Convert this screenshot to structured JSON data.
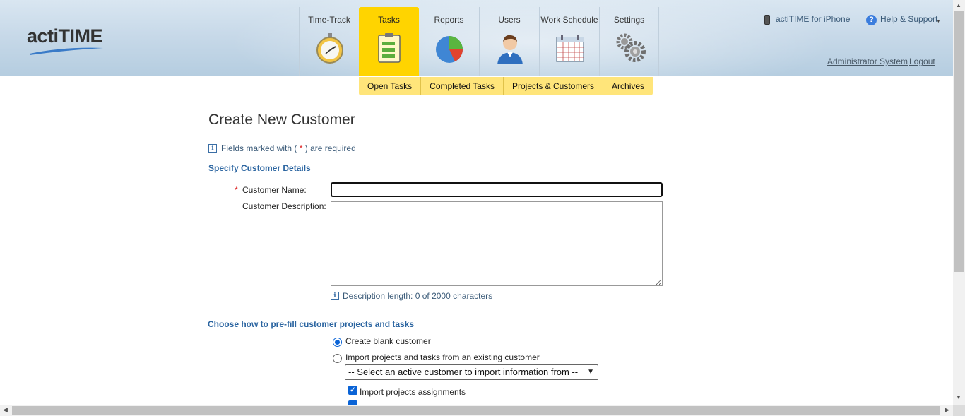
{
  "header": {
    "logo_text": "actiTIME",
    "nav_tabs": [
      {
        "label": "Time-Track",
        "icon": "stopwatch-icon",
        "active": false
      },
      {
        "label": "Tasks",
        "icon": "clipboard-icon",
        "active": true
      },
      {
        "label": "Reports",
        "icon": "pie-chart-icon",
        "active": false
      },
      {
        "label": "Users",
        "icon": "user-icon",
        "active": false
      },
      {
        "label": "Work Schedule",
        "icon": "calendar-icon",
        "active": false
      },
      {
        "label": "Settings",
        "icon": "gears-icon",
        "active": false
      }
    ],
    "iphone_link": "actiTIME for iPhone",
    "help_link": "Help & Support",
    "user_name": "Administrator System",
    "logout_link": "Logout",
    "active_color": "#ffd400"
  },
  "subnav": {
    "items": [
      "Open Tasks",
      "Completed Tasks",
      "Projects & Customers",
      "Archives"
    ]
  },
  "page": {
    "title": "Create New Customer",
    "required_note_prefix": "Fields marked with (",
    "required_star": "*",
    "required_note_suffix": ") are required",
    "section_details": "Specify Customer Details",
    "customer_name_label": "Customer Name:",
    "customer_name_value": "",
    "customer_description_label": "Customer Description:",
    "customer_description_value": "",
    "description_length_note": "Description length: 0 of 2000 characters",
    "section_prefill": "Choose how to pre-fill customer projects and tasks",
    "option_blank": "Create blank customer",
    "option_import": "Import projects and tasks from an existing customer",
    "import_select_value": "-- Select an active customer to import information from --",
    "import_assignments_label": "Import projects assignments",
    "selected_option": "blank"
  }
}
